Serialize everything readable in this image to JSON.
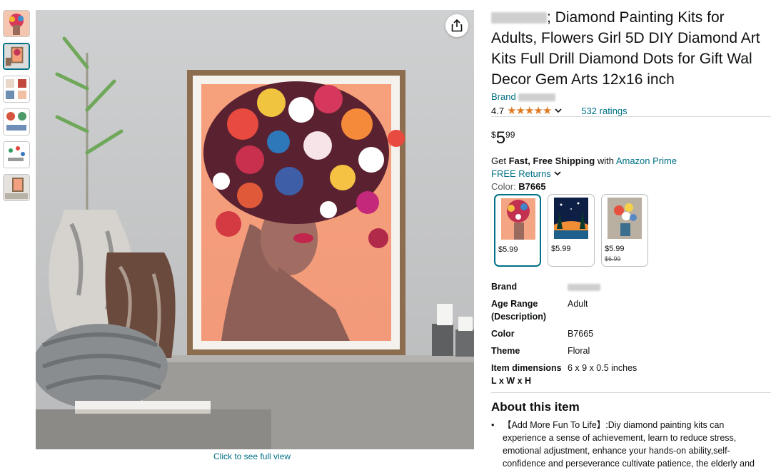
{
  "gallery": {
    "thumbnails": [
      "thumb-1",
      "thumb-2",
      "thumb-3",
      "thumb-4",
      "thumb-5",
      "thumb-6"
    ],
    "full_view_link": "Click to see full view"
  },
  "product": {
    "title_prefix_blurred": "▓▓▓▓▓",
    "title_line1": "; Diamond Painting Kits for",
    "title_line2": "Adults, Flowers Girl 5D DIY Diamond Art",
    "title_line3": "Kits Full Drill Diamond Dots for Gift Wal",
    "title_line4": "Decor Gem Arts 12x16 inch",
    "brand_label": "Brand",
    "rating_value": "4.7",
    "rating_stars": "★★★★★",
    "ratings_count": "532 ratings",
    "price_currency": "$",
    "price_whole": "5",
    "price_fraction": "99",
    "shipping_prefix": "Get ",
    "shipping_bold": "Fast, Free Shipping",
    "shipping_with": " with ",
    "shipping_link": "Amazon Prime",
    "returns_label": "FREE Returns",
    "color_label": "Color: ",
    "color_value": "B7665"
  },
  "swatches": [
    {
      "price": "$5.99",
      "old_price": ""
    },
    {
      "price": "$5.99",
      "old_price": ""
    },
    {
      "price": "$5.99",
      "old_price": "$6.99"
    }
  ],
  "specs": [
    {
      "key": "Brand",
      "value": ""
    },
    {
      "key": "Age Range (Description)",
      "value": "Adult"
    },
    {
      "key": "Color",
      "value": "B7665"
    },
    {
      "key": "Theme",
      "value": "Floral"
    },
    {
      "key": "Item dimensions L x W x H",
      "value": "6 x 9 x 0.5 inches"
    }
  ],
  "about": {
    "title": "About this item",
    "bullet1_line1": "【Add More Fun To Life】:Diy diamond painting kits can",
    "bullet1_line2": "experience a sense of achievement, learn to reduce stress,",
    "bullet1_line3": "emotional adjustment, enhance your hands-on ability,self-",
    "bullet1_line4": "confidence and perseverance cultivate patience, the elderly and"
  },
  "colors": {
    "link": "#007185",
    "star": "#de7921",
    "selected_border": "#007185"
  },
  "icons": {
    "share": "share-icon",
    "chevron": "chevron-down-icon"
  }
}
